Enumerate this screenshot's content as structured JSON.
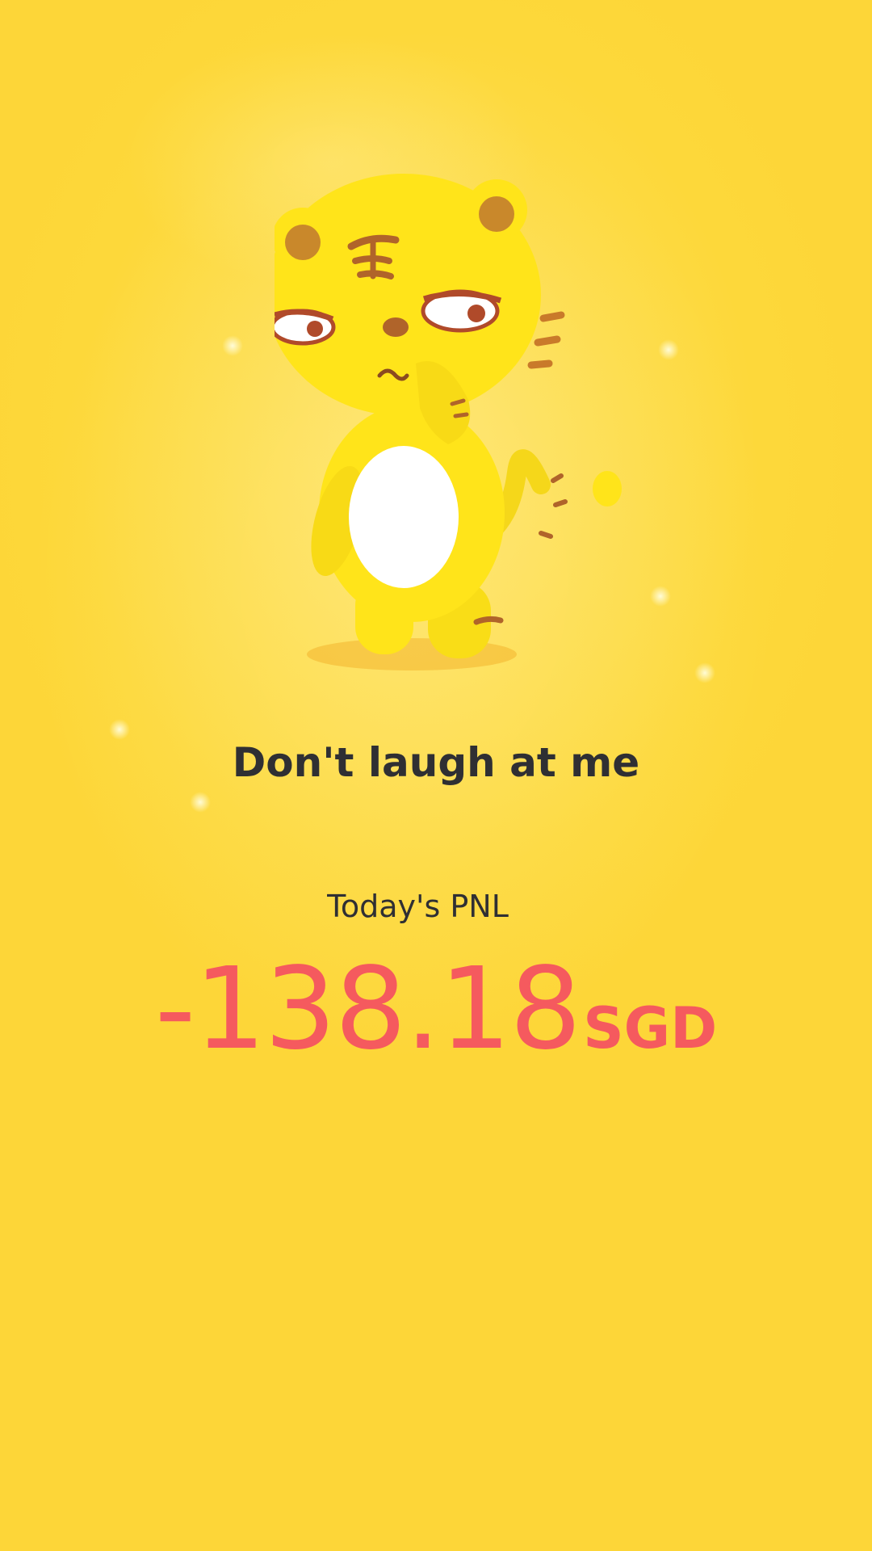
{
  "mascot": {
    "icon": "tiger-mascot-icon"
  },
  "caption": "Don't laugh at me",
  "pnl": {
    "label": "Today's PNL",
    "amount": "-138.18",
    "currency": "SGD"
  },
  "colors": {
    "background": "#fdd83a",
    "caption_text": "#2f2f33",
    "negative": "#f55a5e",
    "mascot_body": "#ffe41a"
  }
}
